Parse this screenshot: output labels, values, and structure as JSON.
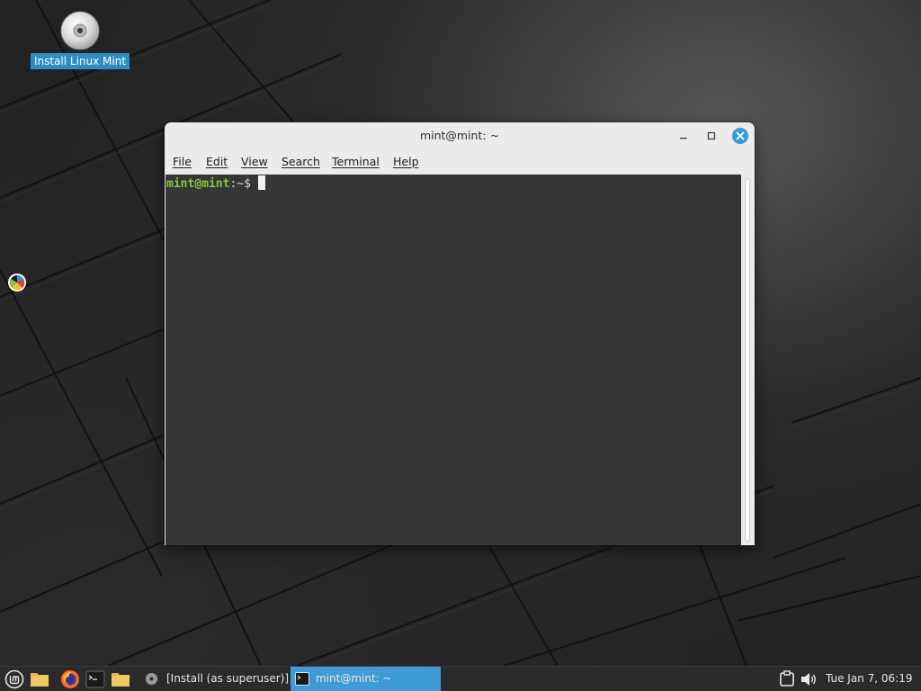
{
  "desktop": {
    "icons": [
      {
        "label": "Install Linux Mint",
        "icon": "dvd-disc-icon"
      }
    ],
    "side_widget_icon": "color-wheel-icon"
  },
  "terminal": {
    "title": "mint@mint: ~",
    "menu": [
      "File",
      "Edit",
      "View",
      "Search",
      "Terminal",
      "Help"
    ],
    "prompt_user": "mint@mint",
    "prompt_path": ":~$",
    "colors": {
      "background": "#363636",
      "prompt_user": "#8ac43f",
      "close_button": "#3a9ad9"
    }
  },
  "taskbar": {
    "launchers": [
      {
        "icon": "linux-mint-menu-icon"
      },
      {
        "icon": "files-folder-icon"
      },
      {
        "icon": "firefox-icon"
      },
      {
        "icon": "terminal-icon"
      },
      {
        "icon": "files-folder-icon"
      }
    ],
    "tasks": [
      {
        "label": "[Install (as superuser)]",
        "icon": "disc-icon",
        "active": false
      },
      {
        "label": "mint@mint: ~",
        "icon": "terminal-icon",
        "active": true
      }
    ],
    "tray": [
      {
        "icon": "network-icon"
      },
      {
        "icon": "volume-icon"
      }
    ],
    "clock": "Tue Jan  7, 06:19",
    "accent_color": "#3e9bd6"
  }
}
